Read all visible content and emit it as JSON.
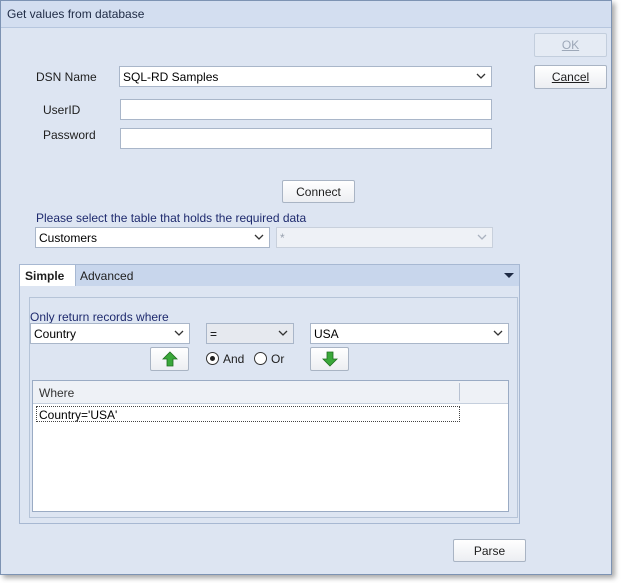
{
  "window": {
    "title": "Get values from database"
  },
  "buttons": {
    "ok": "OK",
    "cancel": "Cancel",
    "connect": "Connect",
    "parse": "Parse"
  },
  "connection": {
    "dsn_label": "DSN Name",
    "dsn_value": "SQL-RD Samples",
    "userid_label": "UserID",
    "userid_value": "",
    "password_label": "Password",
    "password_value": ""
  },
  "table_select": {
    "prompt": "Please select the table that holds the required data",
    "table_value": "Customers",
    "column_value": "*"
  },
  "tabs": {
    "simple": "Simple",
    "advanced": "Advanced"
  },
  "filter": {
    "heading": "Only return records where",
    "field_value": "Country",
    "operator_value": "=",
    "criteria_value": "USA",
    "and_label": "And",
    "or_label": "Or",
    "selected_conjunction": "And"
  },
  "where_grid": {
    "header": "Where",
    "rows": [
      "Country='USA'"
    ]
  },
  "colors": {
    "window_bg": "#dde5f2",
    "arrow_green": "#3aa83a"
  }
}
